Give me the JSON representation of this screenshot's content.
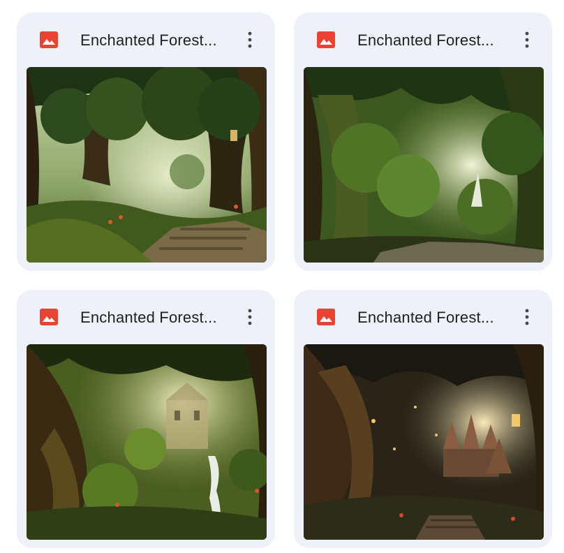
{
  "files": [
    {
      "title": "Enchanted Forest...",
      "icon": "image-file-icon",
      "thumbnail": "enchanted-forest-path-stone-steps",
      "icon_color": "#ea4335"
    },
    {
      "title": "Enchanted Forest...",
      "icon": "image-file-icon",
      "thumbnail": "enchanted-forest-sunlit-trail",
      "icon_color": "#ea4335"
    },
    {
      "title": "Enchanted Forest...",
      "icon": "image-file-icon",
      "thumbnail": "enchanted-forest-hidden-castle-waterfall",
      "icon_color": "#ea4335"
    },
    {
      "title": "Enchanted Forest...",
      "icon": "image-file-icon",
      "thumbnail": "enchanted-forest-castle-lanterns",
      "icon_color": "#ea4335"
    }
  ],
  "colors": {
    "card_background": "#eef2f8",
    "title_text": "#1f1f1f",
    "menu_icon": "#444746"
  },
  "more_icon": "more-vert-icon"
}
